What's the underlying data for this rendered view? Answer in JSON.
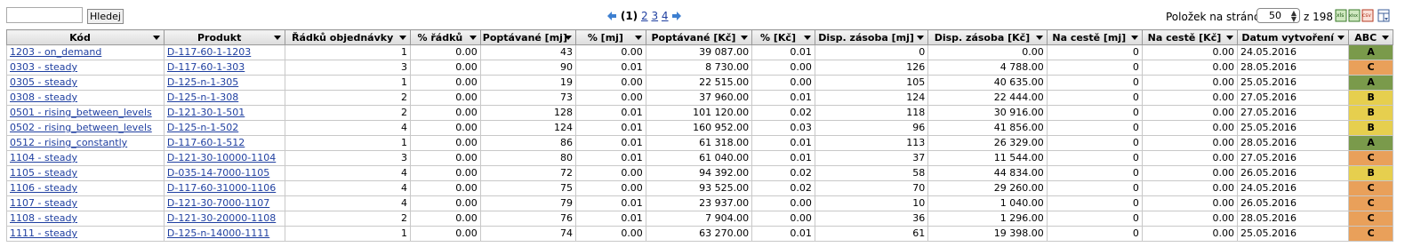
{
  "search": {
    "value": "",
    "button_label": "Hledej"
  },
  "pager": {
    "current": "(1)",
    "pages": [
      "2",
      "3",
      "4"
    ]
  },
  "per_page": {
    "label": "Položek na stránce",
    "value": "50",
    "total": "z 198"
  },
  "export_icons": [
    "excel-xls-icon",
    "excel-xlsx-icon",
    "csv-icon",
    "column-settings-icon"
  ],
  "columns": [
    "Kód",
    "Produkt",
    "Řádků objednávky",
    "% řádků",
    "Poptávané [mj]",
    "% [mj]",
    "Poptávané [Kč]",
    "% [Kč]",
    "Disp. zásoba [mj]",
    "Disp. zásoba [Kč]",
    "Na cestě [mj]",
    "Na cestě [Kč]",
    "Datum vytvoření",
    "ABC"
  ],
  "colors": {
    "A": "#7a9a4b",
    "B": "#e6cf4e",
    "C": "#e9a05a",
    "link": "#1f3fa0"
  },
  "rows": [
    [
      "1203 - on_demand",
      "D-117-60-1-1203",
      "1",
      "0.00",
      "43",
      "0.00",
      "39 087.00",
      "0.01",
      "0",
      "0.00",
      "0",
      "0.00",
      "24.05.2016",
      "A"
    ],
    [
      "0303 - steady",
      "D-117-60-1-303",
      "3",
      "0.00",
      "90",
      "0.01",
      "8 730.00",
      "0.00",
      "126",
      "4 788.00",
      "0",
      "0.00",
      "28.05.2016",
      "C"
    ],
    [
      "0305 - steady",
      "D-125-n-1-305",
      "1",
      "0.00",
      "19",
      "0.00",
      "22 515.00",
      "0.00",
      "105",
      "40 635.00",
      "0",
      "0.00",
      "25.05.2016",
      "A"
    ],
    [
      "0308 - steady",
      "D-125-n-1-308",
      "2",
      "0.00",
      "73",
      "0.00",
      "37 960.00",
      "0.01",
      "124",
      "22 444.00",
      "0",
      "0.00",
      "27.05.2016",
      "B"
    ],
    [
      "0501 - rising_between_levels",
      "D-121-30-1-501",
      "2",
      "0.00",
      "128",
      "0.01",
      "101 120.00",
      "0.02",
      "118",
      "30 916.00",
      "0",
      "0.00",
      "27.05.2016",
      "B"
    ],
    [
      "0502 - rising_between_levels",
      "D-125-n-1-502",
      "4",
      "0.00",
      "124",
      "0.01",
      "160 952.00",
      "0.03",
      "96",
      "41 856.00",
      "0",
      "0.00",
      "25.05.2016",
      "B"
    ],
    [
      "0512 - rising_constantly",
      "D-117-60-1-512",
      "1",
      "0.00",
      "86",
      "0.01",
      "61 318.00",
      "0.01",
      "113",
      "26 329.00",
      "0",
      "0.00",
      "28.05.2016",
      "A"
    ],
    [
      "1104 - steady",
      "D-121-30-10000-1104",
      "3",
      "0.00",
      "80",
      "0.01",
      "61 040.00",
      "0.01",
      "37",
      "11 544.00",
      "0",
      "0.00",
      "27.05.2016",
      "C"
    ],
    [
      "1105 - steady",
      "D-035-14-7000-1105",
      "4",
      "0.00",
      "72",
      "0.00",
      "94 392.00",
      "0.02",
      "58",
      "44 834.00",
      "0",
      "0.00",
      "26.05.2016",
      "B"
    ],
    [
      "1106 - steady",
      "D-117-60-31000-1106",
      "4",
      "0.00",
      "75",
      "0.00",
      "93 525.00",
      "0.02",
      "70",
      "29 260.00",
      "0",
      "0.00",
      "24.05.2016",
      "C"
    ],
    [
      "1107 - steady",
      "D-121-30-7000-1107",
      "4",
      "0.00",
      "79",
      "0.01",
      "23 937.00",
      "0.00",
      "10",
      "1 040.00",
      "0",
      "0.00",
      "26.05.2016",
      "C"
    ],
    [
      "1108 - steady",
      "D-121-30-20000-1108",
      "2",
      "0.00",
      "76",
      "0.01",
      "7 904.00",
      "0.00",
      "36",
      "1 296.00",
      "0",
      "0.00",
      "28.05.2016",
      "C"
    ],
    [
      "1111 - steady",
      "D-125-n-14000-1111",
      "1",
      "0.00",
      "74",
      "0.00",
      "63 270.00",
      "0.01",
      "61",
      "19 398.00",
      "0",
      "0.00",
      "25.05.2016",
      "C"
    ]
  ]
}
